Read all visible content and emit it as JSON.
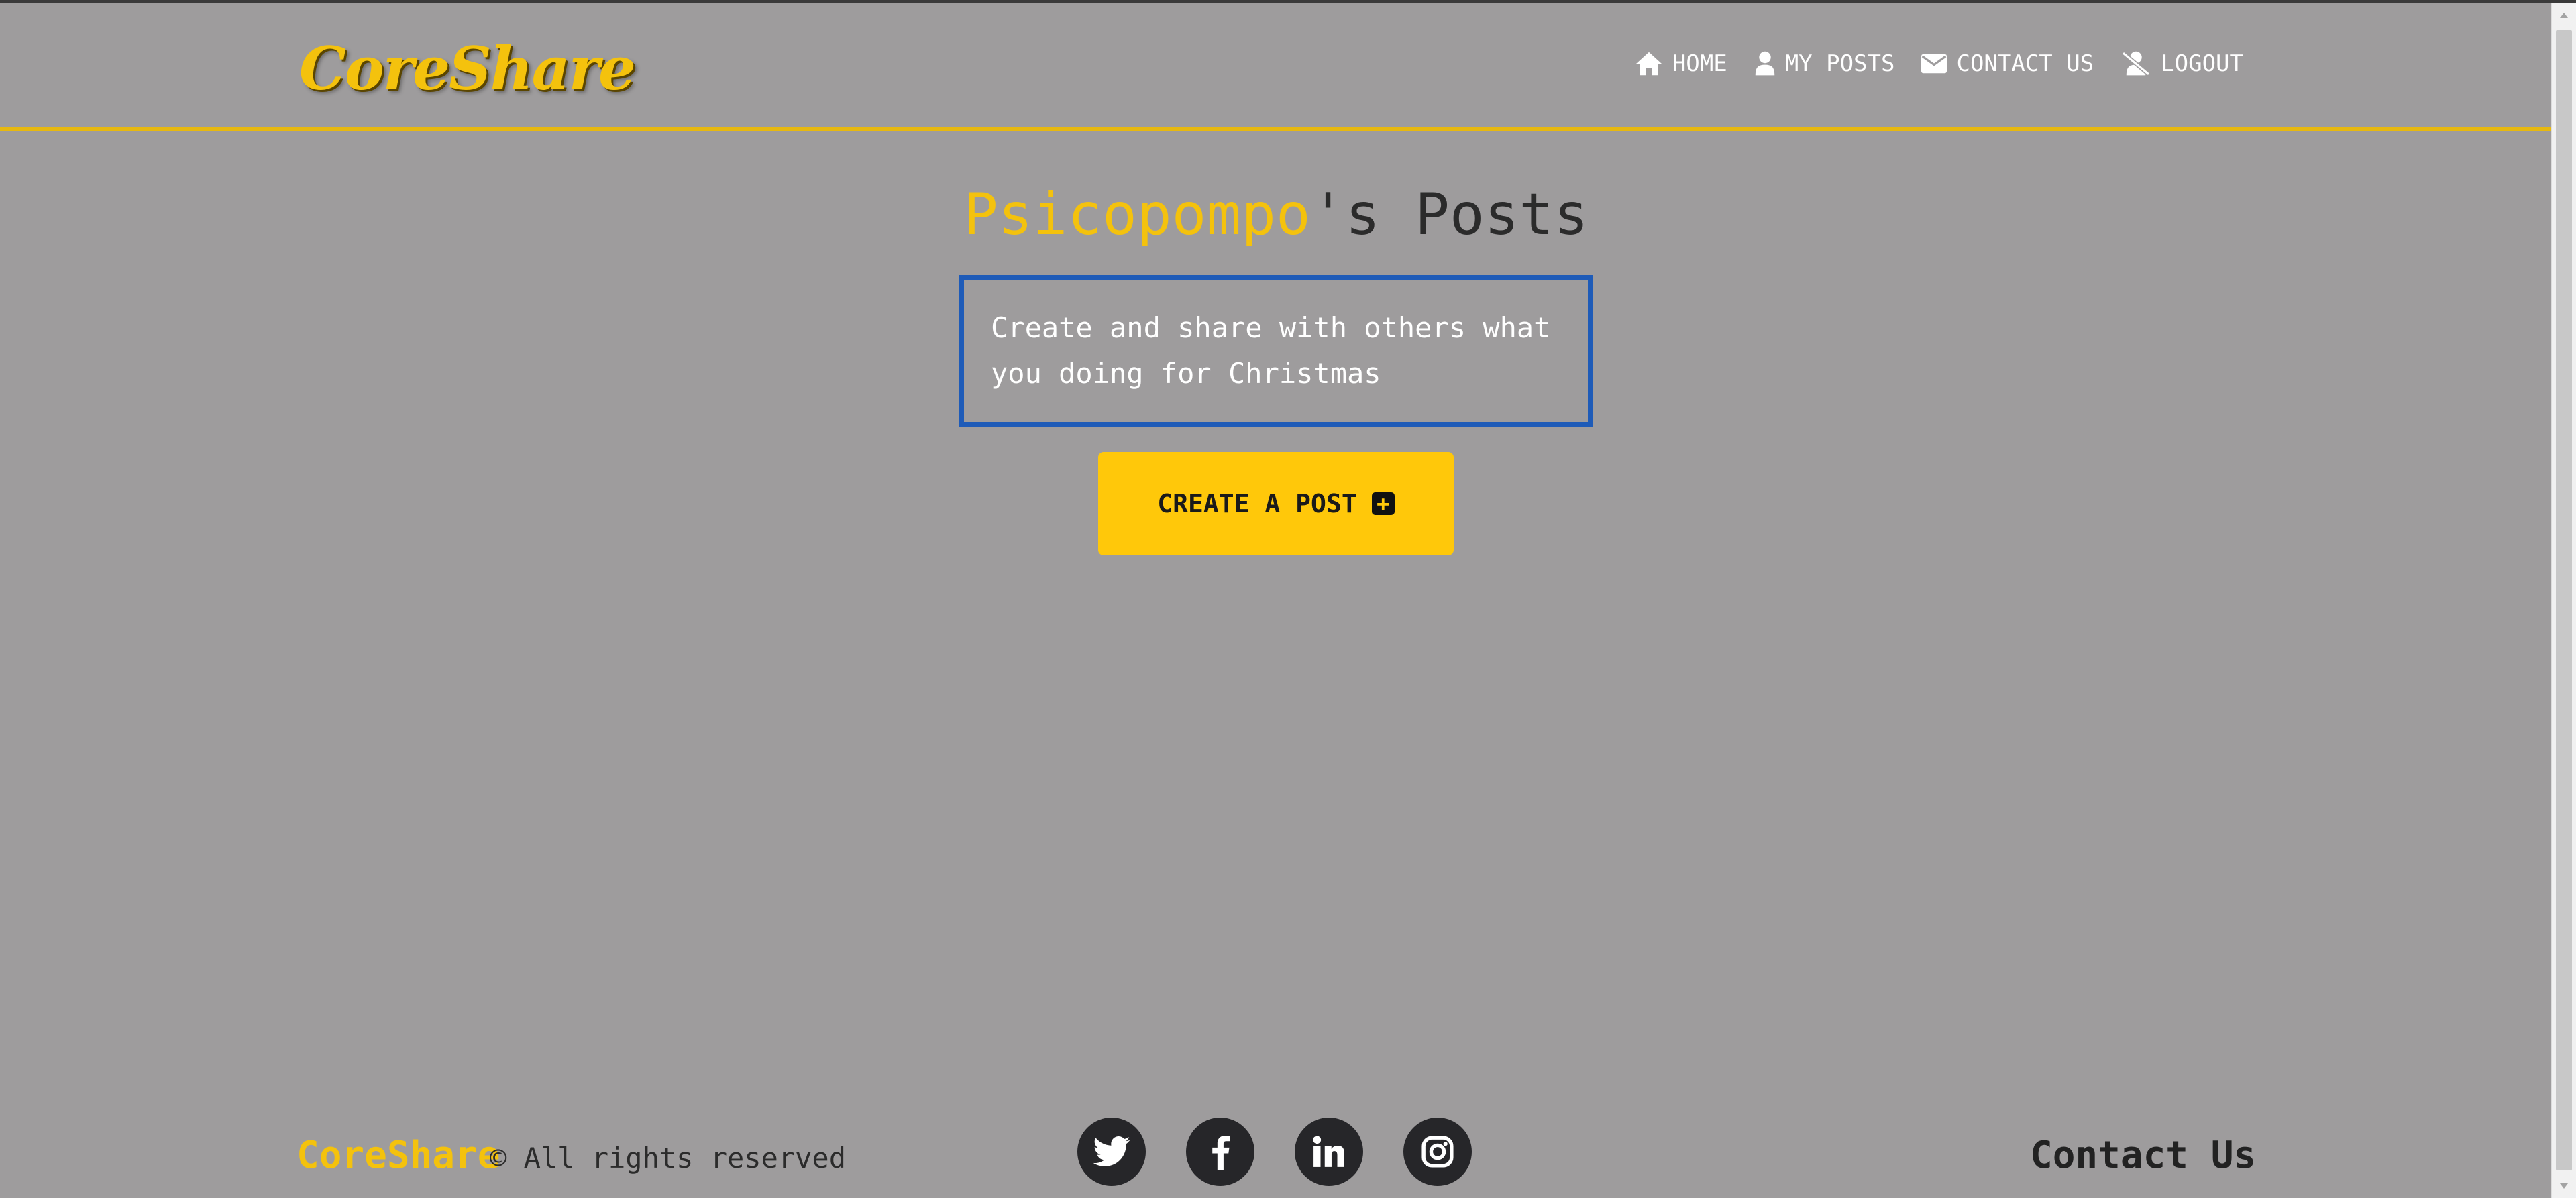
{
  "brand": {
    "logo_text": "CoreShare"
  },
  "nav": {
    "items": [
      {
        "label": "HOME",
        "icon": "home-icon"
      },
      {
        "label": "MY POSTS",
        "icon": "user-icon"
      },
      {
        "label": "CONTACT US",
        "icon": "envelope-icon"
      },
      {
        "label": "LOGOUT",
        "icon": "user-slash-icon"
      }
    ]
  },
  "main": {
    "username": "Psicopompo",
    "title_suffix": "'s Posts",
    "description": "Create and share with others what you doing for Christmas",
    "create_button_label": "CREATE A POST",
    "create_button_icon": "plus-square-icon"
  },
  "footer": {
    "brand": "CoreShare",
    "rights": "© All rights reserved",
    "socials": [
      "twitter-icon",
      "facebook-icon",
      "linkedin-icon",
      "instagram-icon"
    ],
    "contact_label": "Contact Us"
  },
  "colors": {
    "background": "#9e9c9d",
    "accent": "#f4c20d",
    "button": "#ffc80a",
    "box_border": "#1e5bb8"
  }
}
